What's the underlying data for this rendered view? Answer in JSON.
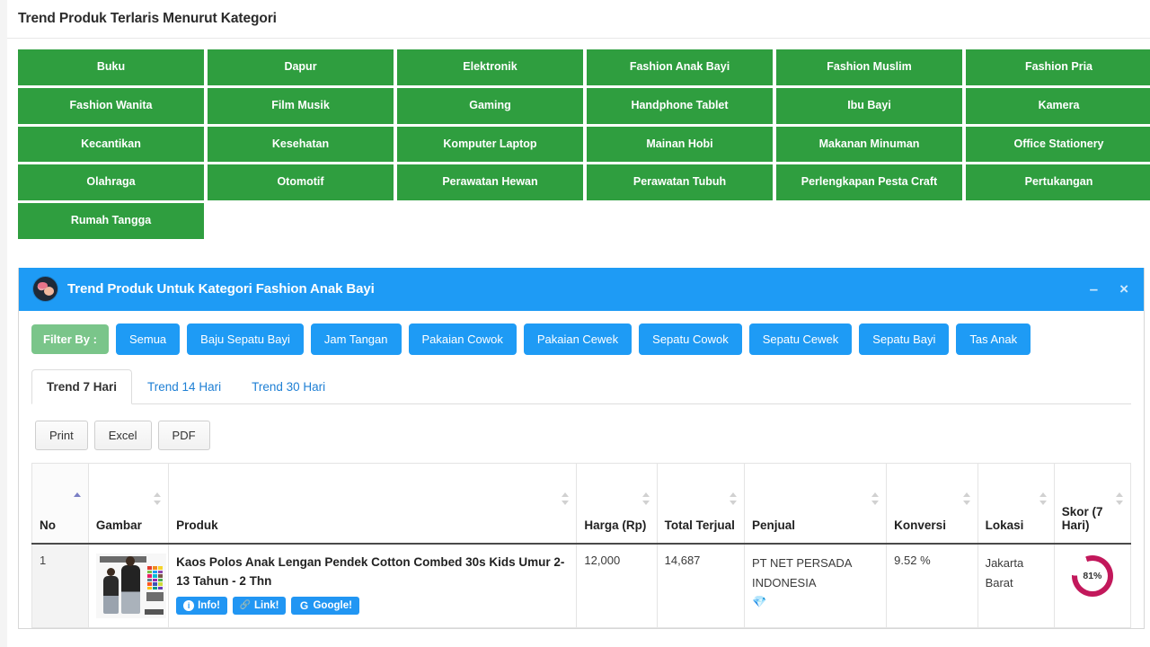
{
  "page": {
    "title": "Trend Produk Terlaris Menurut Kategori"
  },
  "categories": [
    "Buku",
    "Dapur",
    "Elektronik",
    "Fashion Anak Bayi",
    "Fashion Muslim",
    "Fashion Pria",
    "Fashion Wanita",
    "Film Musik",
    "Gaming",
    "Handphone Tablet",
    "Ibu Bayi",
    "Kamera",
    "Kecantikan",
    "Kesehatan",
    "Komputer Laptop",
    "Mainan Hobi",
    "Makanan Minuman",
    "Office Stationery",
    "Olahraga",
    "Otomotif",
    "Perawatan Hewan",
    "Perawatan Tubuh",
    "Perlengkapan Pesta Craft",
    "Pertukangan",
    "Rumah Tangga"
  ],
  "panel": {
    "icon": "user-avatar-icon",
    "title": "Trend Produk Untuk Kategori Fashion Anak Bayi",
    "minimize_label": "–",
    "close_label": "×",
    "header_color": "#1e9bf5"
  },
  "filter": {
    "label": "Filter By :",
    "label_color": "#7ac58a",
    "button_color": "#1e9bf5",
    "options": [
      "Semua",
      "Baju Sepatu Bayi",
      "Jam Tangan",
      "Pakaian Cowok",
      "Pakaian Cewek",
      "Sepatu Cowok",
      "Sepatu Cewek",
      "Sepatu Bayi",
      "Tas Anak"
    ]
  },
  "tabs": [
    {
      "label": "Trend 7 Hari",
      "active": true
    },
    {
      "label": "Trend 14 Hari",
      "active": false
    },
    {
      "label": "Trend 30 Hari",
      "active": false
    }
  ],
  "export_buttons": [
    "Print",
    "Excel",
    "PDF"
  ],
  "table": {
    "columns": [
      {
        "label": "No",
        "sort": "asc"
      },
      {
        "label": "Gambar",
        "sort": "none"
      },
      {
        "label": "Produk",
        "sort": "none"
      },
      {
        "label": "Harga (Rp)",
        "sort": "none"
      },
      {
        "label": "Total Terjual",
        "sort": "none"
      },
      {
        "label": "Penjual",
        "sort": "none"
      },
      {
        "label": "Konversi",
        "sort": "none"
      },
      {
        "label": "Lokasi",
        "sort": "none"
      },
      {
        "label": "Skor (7 Hari)",
        "sort": "none"
      }
    ],
    "rows": [
      {
        "no": "1",
        "image_alt": "product-thumbnail",
        "produk": "Kaos Polos Anak Lengan Pendek Cotton Combed 30s Kids Umur 2-13 Tahun - 2 Thn",
        "actions": [
          {
            "label": "Info!",
            "icon": "info-icon"
          },
          {
            "label": "Link!",
            "icon": "link-icon"
          },
          {
            "label": "Google!",
            "icon": "google-icon"
          }
        ],
        "harga": "12,000",
        "total_terjual": "14,687",
        "penjual": "PT NET PERSADA INDONESIA",
        "penjual_badge": "💎",
        "konversi": "9.52 %",
        "lokasi": "Jakarta Barat",
        "skor": "81%",
        "skor_value": 81,
        "skor_color": "#c2185b"
      }
    ]
  }
}
